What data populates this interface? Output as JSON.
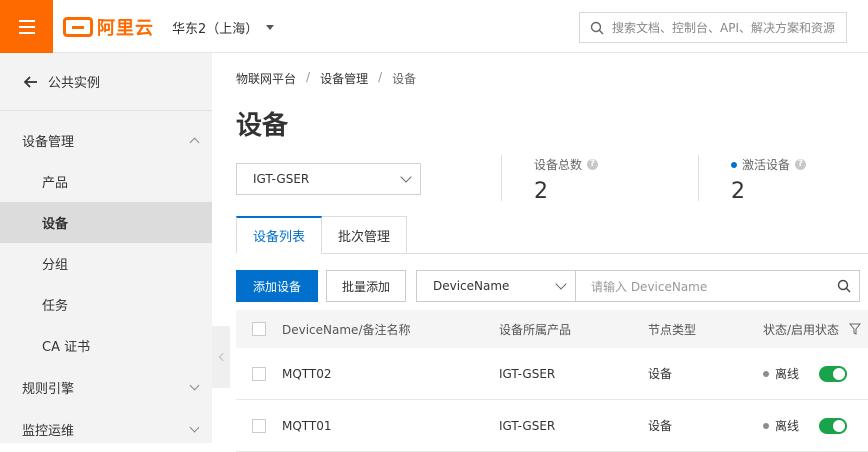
{
  "header": {
    "logo_text": "阿里云",
    "region": "华东2（上海）",
    "search_placeholder": "搜索文档、控制台、API、解决方案和资源"
  },
  "sidebar": {
    "back_label": "公共实例",
    "groups": [
      {
        "label": "设备管理",
        "expanded": true
      },
      {
        "label": "规则引擎",
        "expanded": false
      },
      {
        "label": "监控运维",
        "expanded": false
      }
    ],
    "items": [
      {
        "label": "产品"
      },
      {
        "label": "设备",
        "active": true
      },
      {
        "label": "分组"
      },
      {
        "label": "任务"
      },
      {
        "label": "CA 证书"
      }
    ]
  },
  "breadcrumb": [
    "物联网平台",
    "设备管理",
    "设备"
  ],
  "page_title": "设备",
  "product_select": {
    "value": "IGT-GSER"
  },
  "stats": [
    {
      "label": "设备总数",
      "value": "2"
    },
    {
      "label": "激活设备",
      "value": "2"
    }
  ],
  "tabs": [
    {
      "label": "设备列表",
      "active": true
    },
    {
      "label": "批次管理",
      "active": false
    }
  ],
  "toolbar": {
    "add_device": "添加设备",
    "batch_add": "批量添加",
    "filter_field": "DeviceName",
    "filter_placeholder": "请输入 DeviceName"
  },
  "table": {
    "columns": [
      "DeviceName/备注名称",
      "设备所属产品",
      "节点类型",
      "状态/启用状态"
    ],
    "rows": [
      {
        "name": "MQTT02",
        "product": "IGT-GSER",
        "type": "设备",
        "status": "离线",
        "enabled": true
      },
      {
        "name": "MQTT01",
        "product": "IGT-GSER",
        "type": "设备",
        "status": "离线",
        "enabled": true
      }
    ]
  },
  "colors": {
    "brand": "#ff6a00",
    "primary": "#0070cc",
    "toggle_on": "#1aa34a"
  }
}
